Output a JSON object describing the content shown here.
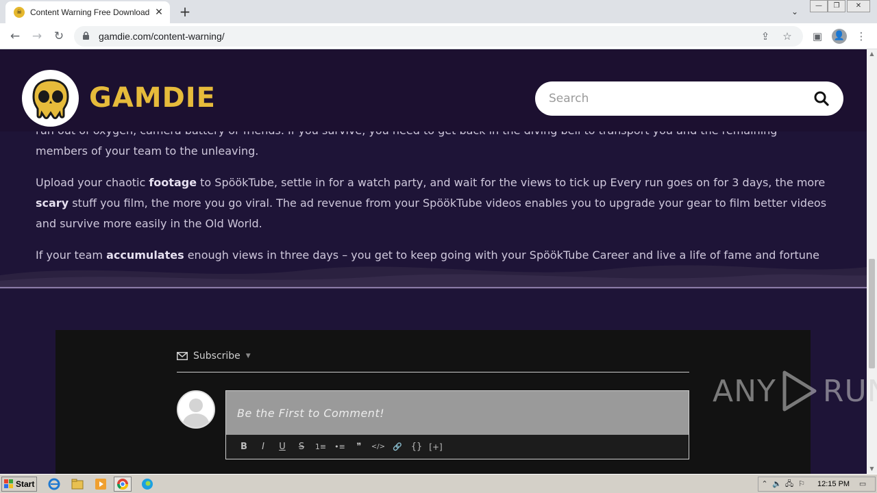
{
  "browser": {
    "tab_title": "Content Warning Free Download (v",
    "url": "gamdie.com/content-warning/",
    "new_tab": "+",
    "close_tab": "✕"
  },
  "site": {
    "logo_text": "GAMDIE",
    "search_placeholder": "Search"
  },
  "article": {
    "p1": "run out of oxygen, camera battery or friends. If you survive, you need to get back in the diving bell to transport you and the remaining members of your team to the unleaving.",
    "p2_a": "Upload your chaotic ",
    "p2_b": "footage",
    "p2_c": " to SpöökTube, settle in for a watch party, and wait for the views to tick up Every run goes on for 3 days, the more ",
    "p2_d": "scary",
    "p2_e": " stuff you film, the more you go viral. The ad revenue from your SpöökTube videos enables you to upgrade your gear to film better videos and survive more easily in the Old World.",
    "p3_a": "If your team ",
    "p3_b": "accumulates",
    "p3_c": " enough views in three days – you get to keep going with your SpöökTube Career and live a life of fame and fortune"
  },
  "comments": {
    "subscribe_label": "Subscribe",
    "editor_placeholder": "Be the First to Comment!",
    "tools": [
      "B",
      "I",
      "U",
      "S",
      "1≡",
      "•≡",
      "❞",
      "</>",
      "🔗",
      "{}",
      "[+]"
    ]
  },
  "watermark": {
    "left": "ANY",
    "right": "RUN"
  },
  "taskbar": {
    "start_label": "Start",
    "clock": "12:15 PM"
  }
}
